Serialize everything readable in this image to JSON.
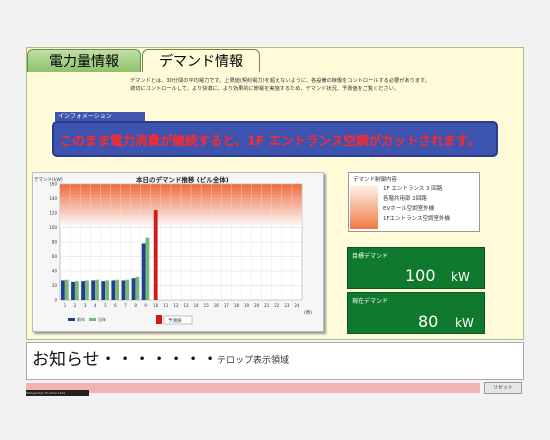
{
  "tabs": [
    {
      "label": "電力量情報",
      "active": false
    },
    {
      "label": "デマンド情報",
      "active": true
    }
  ],
  "description": "デマンドとは、30分間の平均電力です。上限値(契約電力)を超えないように、各設備の稼働をコントロールする必要があります。\n適切にコントロールして、より快適に、より効果的に節電を実施するため、デマンド状況、予測値をご覧ください。",
  "info": {
    "label": "インフォメーション",
    "message": "このまま電力消費が継続すると、1F エントランス空調がカットされます。"
  },
  "chart_data": {
    "type": "bar",
    "title": "本日のデマンド推移 (ビル全体)",
    "ylabel": "デマンド[kW]",
    "xlabel": "(時)",
    "ylim": [
      0,
      160
    ],
    "yticks": [
      0,
      20,
      40,
      60,
      80,
      100,
      120,
      140,
      160
    ],
    "categories": [
      "1",
      "2",
      "3",
      "4",
      "5",
      "6",
      "7",
      "8",
      "9",
      "10",
      "11",
      "12",
      "13",
      "14",
      "15",
      "16",
      "17",
      "18",
      "19",
      "20",
      "21",
      "22",
      "23",
      "24"
    ],
    "series": [
      {
        "name": "前年",
        "color": "#1f3f8f",
        "values": [
          27,
          25,
          26,
          27,
          26,
          27,
          27,
          30,
          78,
          null,
          null,
          null,
          null,
          null,
          null,
          null,
          null,
          null,
          null,
          null,
          null,
          null,
          null,
          null
        ]
      },
      {
        "name": "当年",
        "color": "#7ab87a",
        "values": [
          28,
          26,
          27,
          28,
          27,
          28,
          28,
          32,
          86,
          null,
          null,
          null,
          null,
          null,
          null,
          null,
          null,
          null,
          null,
          null,
          null,
          null,
          null,
          null
        ]
      }
    ],
    "forecast": {
      "name": "予測値",
      "color": "#d11a1a",
      "category": "10",
      "value": 124
    },
    "target_line": 100
  },
  "control": {
    "title": "デマンド制御内容",
    "items": [
      "1F エントランス 3 回路",
      "各階共用部 2回路",
      "EVホール空調室外機",
      "1Fエントランス空調室外機"
    ]
  },
  "target": {
    "label": "目標デマンド",
    "value": "100",
    "unit": "kW"
  },
  "current": {
    "label": "現在デマンド",
    "value": "80",
    "unit": "kW"
  },
  "notice": {
    "title": "お知らせ・・・・・・・",
    "ticker": "テロップ表示領域"
  },
  "footer": {
    "tag": "MSAppHost TV-2010-1101",
    "reset_label": "リセット"
  }
}
